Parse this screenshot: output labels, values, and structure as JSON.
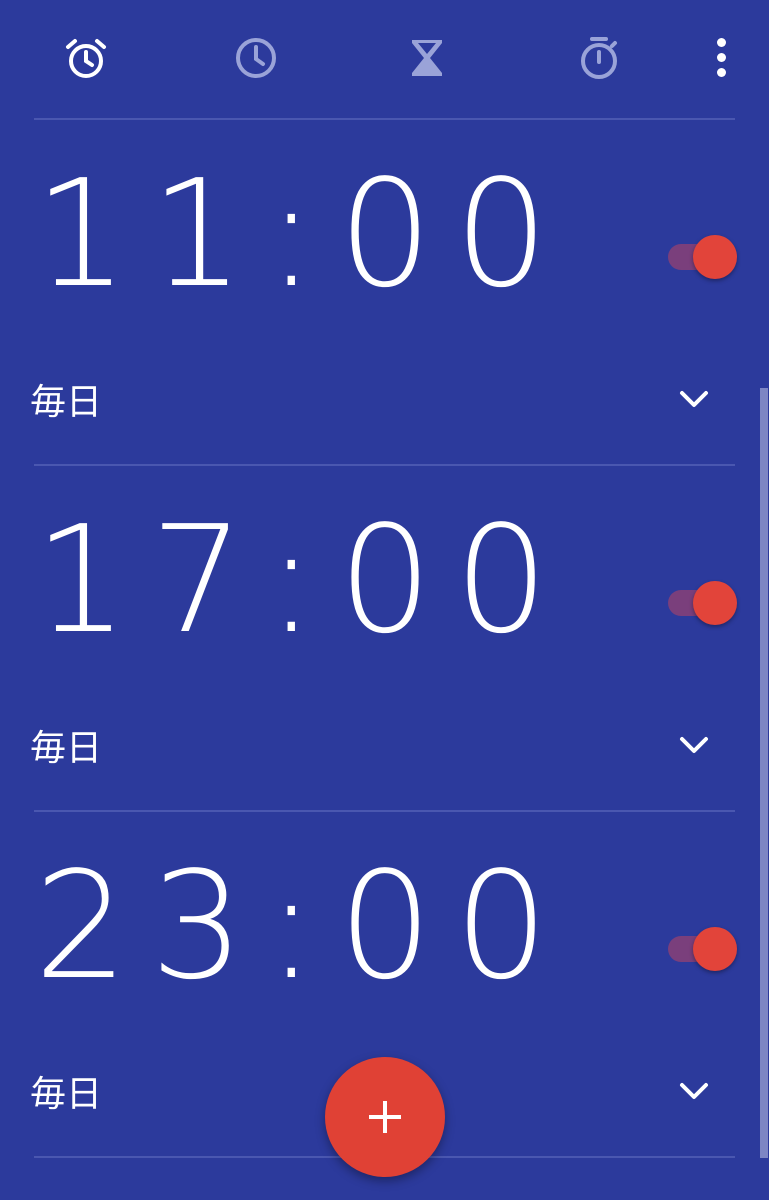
{
  "tabs": [
    {
      "name": "alarm-icon",
      "active": true
    },
    {
      "name": "clock-icon",
      "active": false
    },
    {
      "name": "timer-icon",
      "active": false
    },
    {
      "name": "stopwatch-icon",
      "active": false
    }
  ],
  "menu_icon": "more-vert-icon",
  "alarms": [
    {
      "time": "11:00",
      "repeat": "毎日",
      "enabled": true
    },
    {
      "time": "17:00",
      "repeat": "毎日",
      "enabled": true
    },
    {
      "time": "23:00",
      "repeat": "毎日",
      "enabled": true
    }
  ],
  "fab_icon": "add-icon",
  "colors": {
    "background": "#2c3a9c",
    "accent": "#e04135",
    "switch_track_on": "#7a3f7c",
    "divider": "#4a57b0"
  }
}
